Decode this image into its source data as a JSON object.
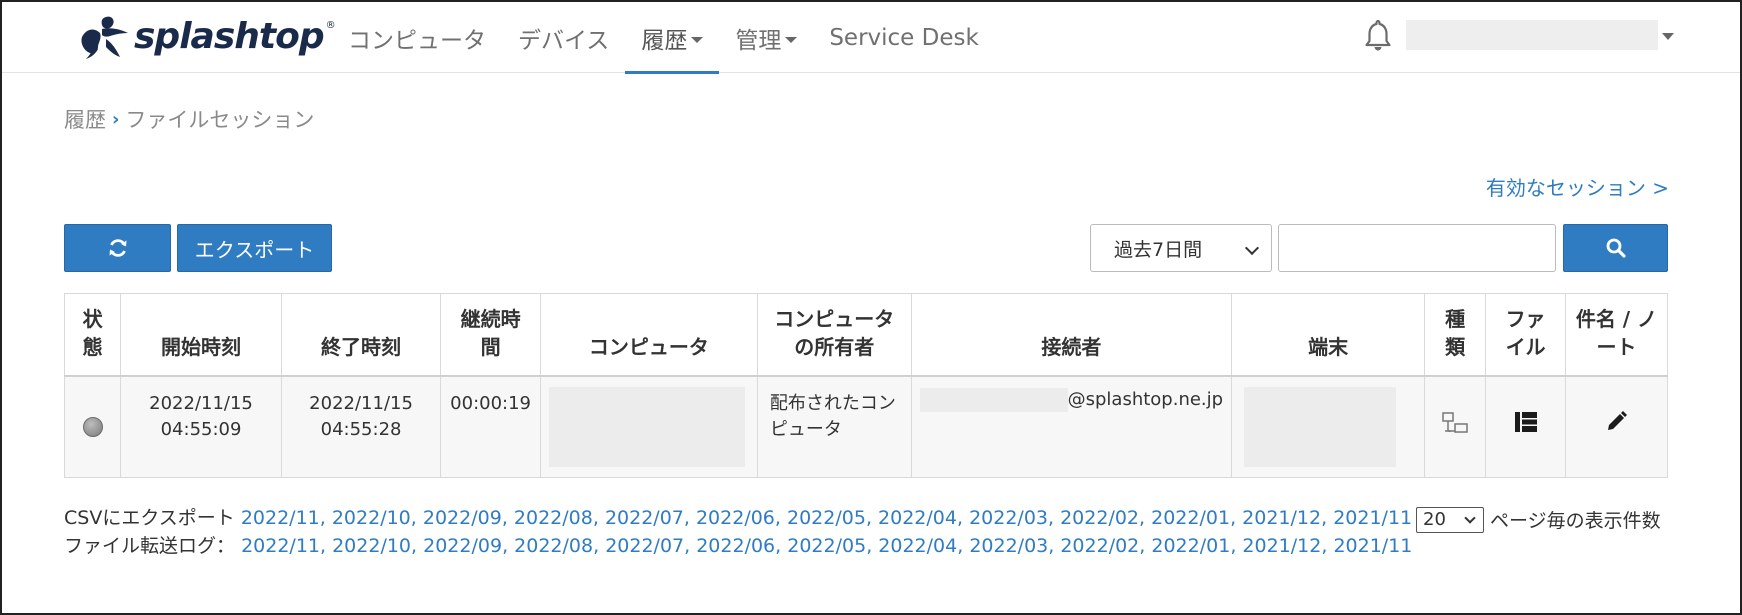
{
  "header": {
    "logo_text": "splashtop",
    "logo_tm": "®",
    "nav": [
      {
        "label": "コンピュータ",
        "dropdown": false,
        "active": false
      },
      {
        "label": "デバイス",
        "dropdown": false,
        "active": false
      },
      {
        "label": "履歴",
        "dropdown": true,
        "active": true
      },
      {
        "label": "管理",
        "dropdown": true,
        "active": false
      },
      {
        "label": "Service Desk",
        "dropdown": false,
        "active": false
      }
    ]
  },
  "breadcrumb": {
    "parent": "履歴",
    "separator": "›",
    "current": "ファイルセッション"
  },
  "active_sessions_link": "有効なセッション >",
  "toolbar": {
    "export_label": "エクスポート",
    "range_selected": "過去7日間",
    "search_placeholder": ""
  },
  "table": {
    "headers": {
      "status": "状\n態",
      "start": "開始時刻",
      "end": "終了時刻",
      "duration": "継続時\n間",
      "computer": "コンピュータ",
      "owner": "コンピュータ\nの所有者",
      "connector": "接続者",
      "terminal": "端末",
      "type": "種\n類",
      "file": "ファ\nイル",
      "subject": "件名 / ノ\nート"
    },
    "rows": [
      {
        "start": "2022/11/15\n04:55:09",
        "end": "2022/11/15\n04:55:28",
        "duration": "00:00:19",
        "owner": "配布されたコン\nピュータ",
        "connector_domain": "@splashtop.ne.jp"
      }
    ]
  },
  "footer": {
    "csv_label": "CSVにエクスポート",
    "csv_months": [
      "2022/11",
      "2022/10",
      "2022/09",
      "2022/08",
      "2022/07",
      "2022/06",
      "2022/05",
      "2022/04",
      "2022/03",
      "2022/02",
      "2022/01",
      "2021/12",
      "2021/11"
    ],
    "log_label": "ファイル転送ログ：",
    "log_months": [
      "2022/11",
      "2022/10",
      "2022/09",
      "2022/08",
      "2022/07",
      "2022/06",
      "2022/05",
      "2022/04",
      "2022/03",
      "2022/02",
      "2022/01",
      "2021/12",
      "2021/11"
    ],
    "per_page_value": "20",
    "per_page_label": "ページ毎の表示件数"
  },
  "colors": {
    "accent": "#2f7cc2",
    "logo": "#1a2a4a"
  },
  "icons": [
    "logo-mark",
    "bell-icon",
    "refresh-icon",
    "search-icon",
    "status-dot",
    "network-type-icon",
    "file-list-icon",
    "pencil-icon"
  ]
}
